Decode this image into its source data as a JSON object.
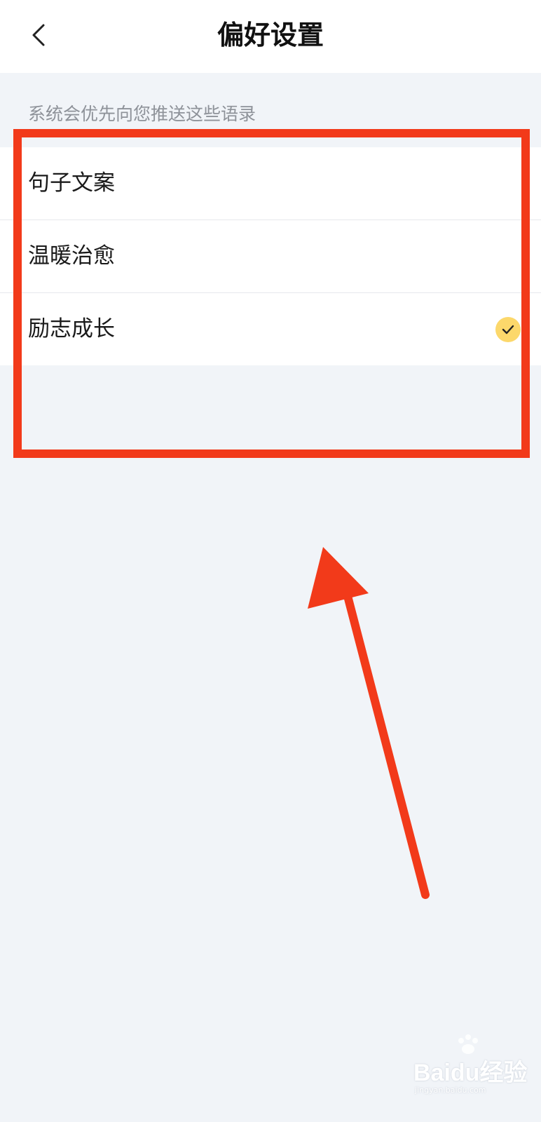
{
  "header": {
    "title": "偏好设置",
    "back_icon": "chevron-left-icon"
  },
  "hint": "系统会优先向您推送这些语录",
  "preferences": [
    {
      "label": "句子文案",
      "selected": false
    },
    {
      "label": "温暖治愈",
      "selected": false
    },
    {
      "label": "励志成长",
      "selected": true
    }
  ],
  "colors": {
    "accent": "#fcd86b",
    "annotation": "#f23a1a",
    "background": "#f1f4f8"
  },
  "watermark": {
    "text": "Baidu经验",
    "sub": "jingyan.baidu.com"
  }
}
